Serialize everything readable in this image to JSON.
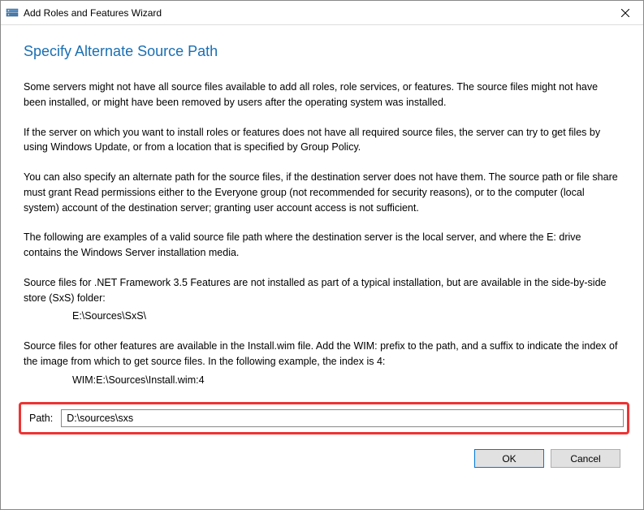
{
  "titlebar": {
    "title": "Add Roles and Features Wizard"
  },
  "heading": "Specify Alternate Source Path",
  "paragraphs": {
    "p1": "Some servers might not have all source files available to add all roles, role services, or features. The source files might not have been installed, or might have been removed by users after the operating system was installed.",
    "p2": "If the server on which you want to install roles or features does not have all required source files, the server can try to get files by using Windows Update, or from a location that is specified by Group Policy.",
    "p3": "You can also specify an alternate path for the source files, if the destination server does not have them. The source path or file share must grant Read permissions either to the Everyone group (not recommended for security reasons), or to the computer (local system) account of the destination server; granting user account access is not sufficient.",
    "p4": "The following are examples of a valid source file path where the destination server is the local server, and where the E: drive contains the Windows Server installation media.",
    "p5": "Source files for .NET Framework 3.5 Features are not installed as part of a typical installation, but are available in the side-by-side store (SxS) folder:",
    "example1": "E:\\Sources\\SxS\\",
    "p6": "Source files for other features are available in the Install.wim file. Add the WIM: prefix to the path, and a suffix to indicate the index of the image from which to get source files. In the following example, the index is 4:",
    "example2": "WIM:E:\\Sources\\Install.wim:4"
  },
  "path": {
    "label": "Path:",
    "value": "D:\\sources\\sxs"
  },
  "buttons": {
    "ok": "OK",
    "cancel": "Cancel"
  }
}
